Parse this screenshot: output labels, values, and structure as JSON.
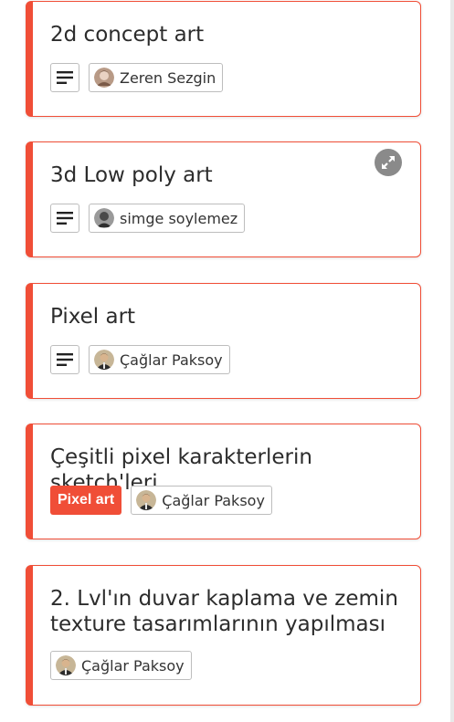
{
  "cards": [
    {
      "title": "2d concept art",
      "member": "Zeren Sezgin"
    },
    {
      "title": "3d Low poly art",
      "member": "simge soylemez"
    },
    {
      "title": "Pixel art",
      "member": "Çağlar Paksoy"
    },
    {
      "title": "Çeşitli pixel karakterlerin sketch'leri",
      "label": "Pixel art",
      "member": "Çağlar Paksoy"
    },
    {
      "title": "2. Lvl'ın duvar kaplama ve zemin texture tasarımlarının yapılması",
      "member": "Çağlar Paksoy"
    }
  ],
  "colors": {
    "accent": "#f04e37",
    "border": "#bdbdbd",
    "expand_button": "#8a8a8a"
  },
  "icons": {
    "description": "description-lines-icon",
    "expand": "expand-arrows-icon"
  }
}
